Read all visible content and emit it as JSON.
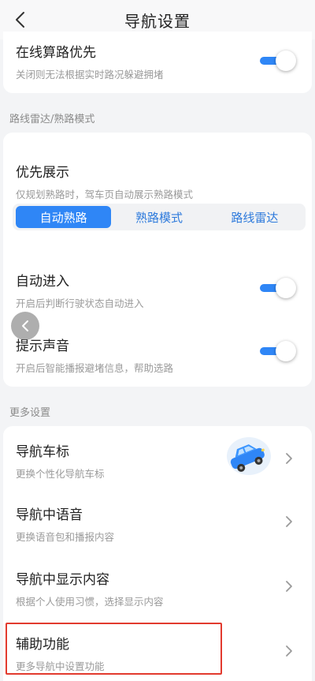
{
  "header": {
    "title": "导航设置"
  },
  "online_route": {
    "title": "在线算路优先",
    "subtitle": "关闭则无法根据实时路况躲避拥堵",
    "enabled": true
  },
  "section_radar": {
    "label": "路线雷达/熟路模式"
  },
  "priority": {
    "title": "优先展示",
    "subtitle": "仅规划熟路时，驾车页自动展示熟路模式",
    "options": [
      "自动熟路",
      "熟路模式",
      "路线雷达"
    ],
    "selected": "自动熟路"
  },
  "auto_enter": {
    "title": "自动进入",
    "subtitle": "开启后判断行驶状态自动进入",
    "enabled": true
  },
  "sound": {
    "title": "提示声音",
    "subtitle": "开启后智能播报避堵信息，帮助选路",
    "enabled": true
  },
  "section_more": {
    "label": "更多设置"
  },
  "more_items": [
    {
      "title": "导航车标",
      "subtitle": "更换个性化导航车标"
    },
    {
      "title": "导航中语音",
      "subtitle": "更换语音包和播报内容"
    },
    {
      "title": "导航中显示内容",
      "subtitle": "根据个人使用习惯，选择显示内容"
    },
    {
      "title": "辅助功能",
      "subtitle": "更多导航中设置功能"
    }
  ],
  "colors": {
    "accent": "#2f86f6",
    "highlight": "#e23a2e"
  },
  "icons": {
    "back": "chevron-left-icon",
    "row_arrow": "chevron-right-icon",
    "car": "car-icon"
  }
}
